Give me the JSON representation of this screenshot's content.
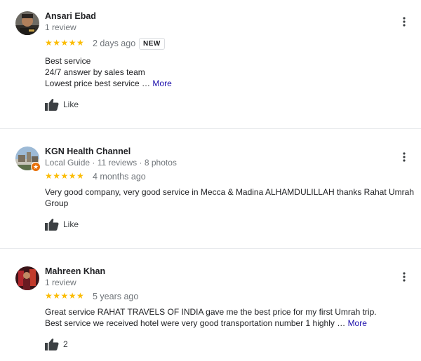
{
  "reviews": [
    {
      "name": "Ansari Ebad",
      "meta": "1 review",
      "stars": "★★★★★",
      "age": "2 days ago",
      "badge": "NEW",
      "lines": [
        "Best service",
        "24/7 answer by sales team",
        "Lowest price best service …"
      ],
      "more": "More",
      "like": "Like",
      "rating": 5
    },
    {
      "name": "KGN Health Channel",
      "meta_guide": "Local Guide",
      "meta_rest": " · 11 reviews · 8 photos",
      "stars": "★★★★★",
      "age": "4 months ago",
      "lines": [
        "Very good company, very good service in Mecca & Madina ALHAMDULILLAH thanks Rahat Umrah",
        "Group"
      ],
      "like": "Like",
      "rating": 5
    },
    {
      "name": "Mahreen Khan",
      "meta": "1 review",
      "stars": "★★★★★",
      "age": "5 years ago",
      "lines": [
        "Great service RAHAT TRAVELS OF INDIA gave me the best price for my first Umrah trip.",
        "Best service we received hotel were very good transportation number 1 highly …"
      ],
      "more": "More",
      "like": "2",
      "rating": 5
    }
  ],
  "icons": {
    "more_options": "more-vert-icon",
    "like": "thumbs-up-icon",
    "guide_badge": "local-guide-star-icon"
  },
  "colors": {
    "star": "#fbbc04",
    "link": "#1a0dab",
    "secondary_text": "#70757a",
    "guide_badge": "#e8710a"
  }
}
